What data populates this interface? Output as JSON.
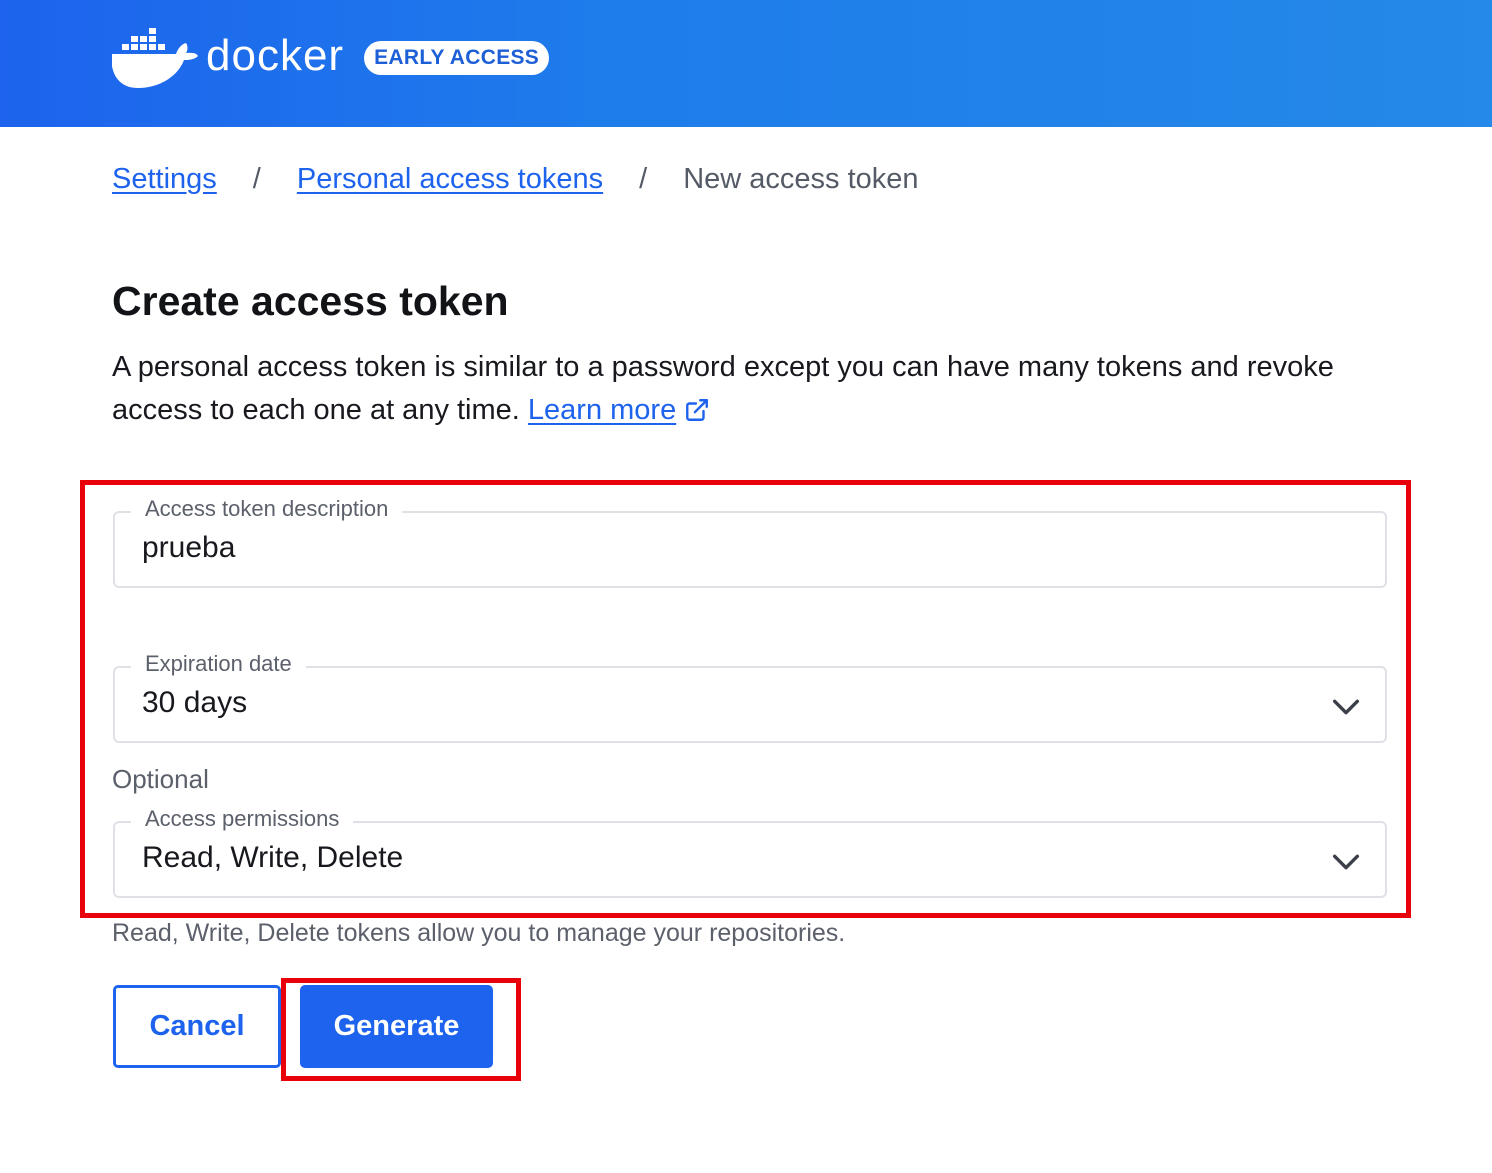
{
  "header": {
    "brand": "docker",
    "badge": "EARLY ACCESS",
    "brand_color": "#1d63ed"
  },
  "breadcrumb": {
    "items": [
      {
        "label": "Settings"
      },
      {
        "label": "Personal access tokens"
      }
    ],
    "separator": "/",
    "current": "New access token"
  },
  "page": {
    "title": "Create access token",
    "description": "A personal access token is similar to a password except you can have many tokens and revoke access to each one at any time.",
    "learn_more": "Learn more"
  },
  "form": {
    "description_field": {
      "label": "Access token description",
      "value": "prueba"
    },
    "expiration_field": {
      "label": "Expiration date",
      "value": "30 days"
    },
    "optional_label": "Optional",
    "permissions_field": {
      "label": "Access permissions",
      "value": "Read, Write, Delete"
    },
    "helper_text": "Read, Write, Delete tokens allow you to manage your repositories."
  },
  "actions": {
    "cancel": "Cancel",
    "generate": "Generate"
  },
  "icons": {
    "logo": "docker-whale-icon",
    "external": "external-link-icon",
    "dropdown": "chevron-down-icon"
  },
  "annotation_color": "#e8000b"
}
